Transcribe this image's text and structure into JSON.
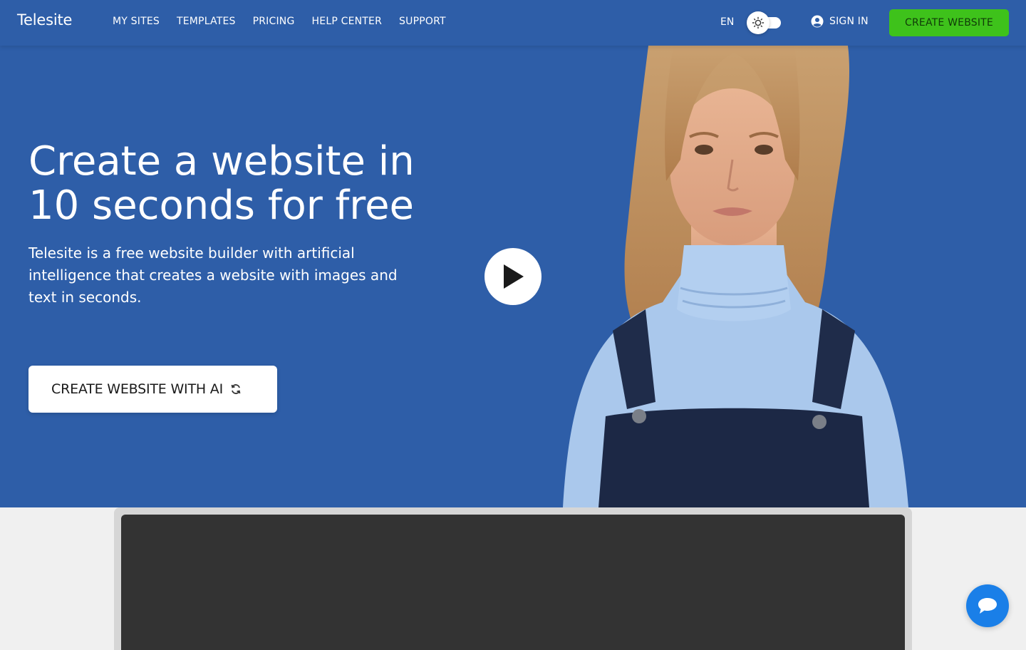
{
  "brand": {
    "name": "Telesite"
  },
  "nav": {
    "links": [
      "MY SITES",
      "TEMPLATES",
      "PRICING",
      "HELP CENTER",
      "SUPPORT"
    ],
    "language": "EN",
    "theme_toggle_icon": "sun-icon",
    "signin_label": "SIGN IN",
    "signin_icon": "user-circle-icon",
    "create_label": "CREATE WEBSITE"
  },
  "hero": {
    "headline_line1": "Create a website in",
    "headline_line2": "10 seconds for free",
    "subtext": "Telesite is a free website builder with artificial intelligence that creates a website with images and text in seconds.",
    "cta_label": "CREATE WEBSITE WITH AI",
    "cta_icon": "refresh-icon",
    "play_icon": "play-icon"
  },
  "chat": {
    "icon": "chat-bubble-icon"
  },
  "colors": {
    "hero_bg": "#2e5ea8",
    "create_button": "#3ec21b",
    "chat_button": "#1a7fe8",
    "frame_dark": "#333333",
    "page_bg": "#f0f0f0"
  }
}
